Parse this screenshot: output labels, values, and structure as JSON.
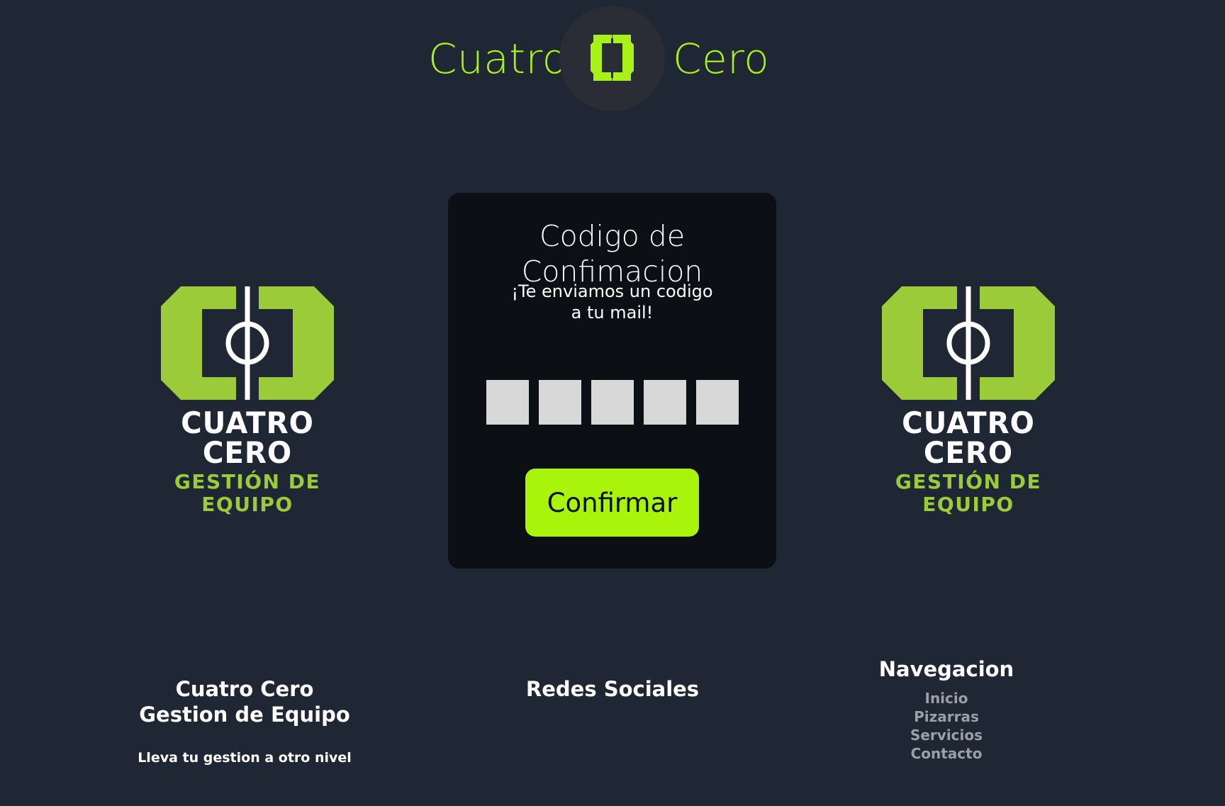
{
  "header": {
    "brand_left": "Cuatro",
    "brand_right": "Cero",
    "accent_color": "#a8f21a",
    "logo_icon": "bracket-circle-logo-icon"
  },
  "side_logos": {
    "title": "CUATRO CERO",
    "subtitle": "GESTIÓN DE EQUIPO",
    "color_green": "#9ccb3a"
  },
  "card": {
    "title": "Codigo de Confimacion",
    "message_line1": "¡Te enviamos un codigo",
    "message_line2": "a tu mail!",
    "code_boxes": [
      "",
      "",
      "",
      "",
      ""
    ],
    "confirm_label": "Confirmar",
    "button_color": "#a8f50b"
  },
  "footer": {
    "brand_title_line1": "Cuatro Cero",
    "brand_title_line2": "Gestion de Equipo",
    "brand_tagline": "Lleva tu gestion a otro nivel",
    "social_title": "Redes Sociales",
    "nav_title": "Navegacion",
    "nav_links": [
      "Inicio",
      "Pizarras",
      "Servicios",
      "Contacto"
    ]
  }
}
